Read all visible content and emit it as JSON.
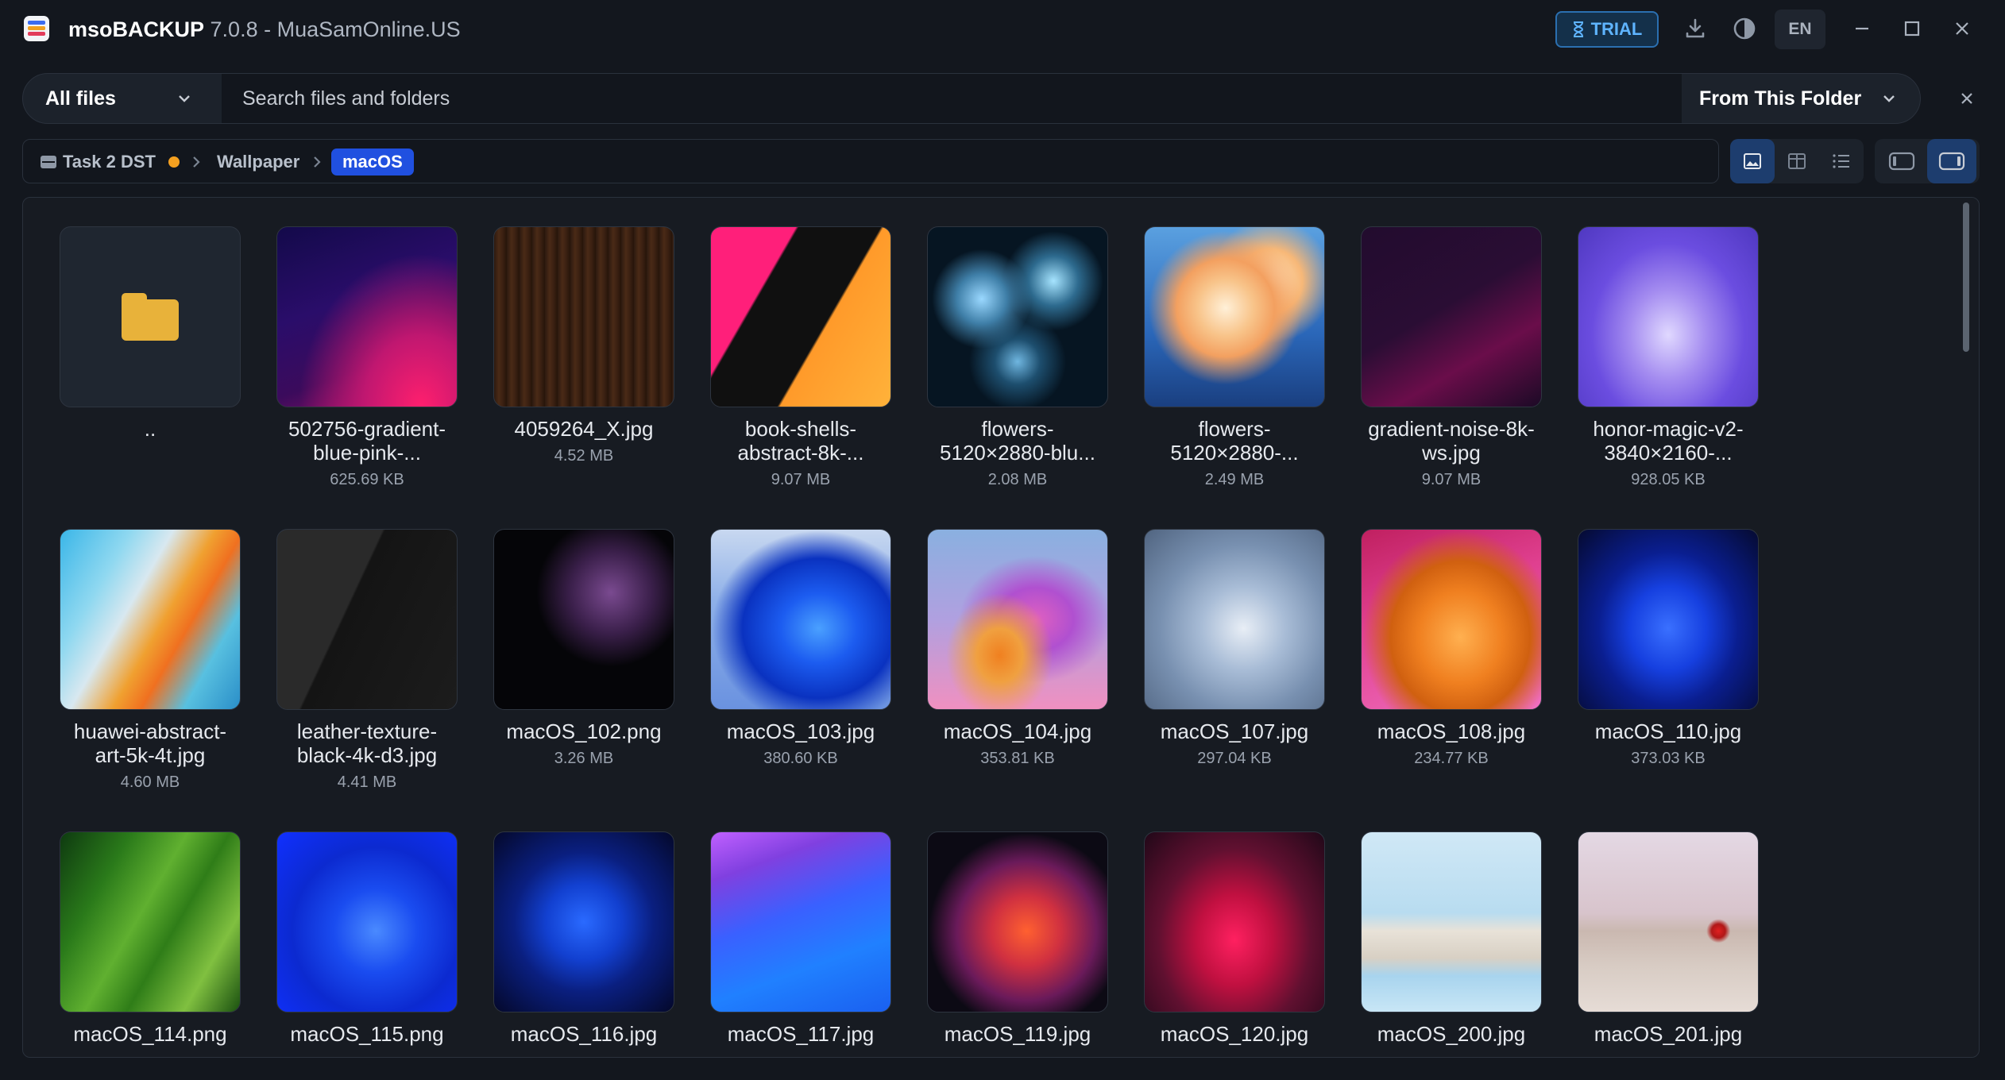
{
  "app": {
    "name": "msoBACKUP",
    "title_rest": " 7.0.8 - MuaSamOnline.US",
    "trial_label": "TRIAL",
    "language": "EN"
  },
  "search": {
    "filter_label": "All files",
    "placeholder": "Search files and folders",
    "value": "",
    "scope_label": "From This Folder"
  },
  "breadcrumb": {
    "items": [
      "Task 2 DST",
      "Wallpaper",
      "macOS"
    ]
  },
  "files": [
    {
      "name": "..",
      "size": "",
      "type": "folder"
    },
    {
      "name": "502756-gradient-blue-pink-...",
      "size": "625.69 KB"
    },
    {
      "name": "4059264_X.jpg",
      "size": "4.52 MB"
    },
    {
      "name": "book-shells-abstract-8k-...",
      "size": "9.07 MB"
    },
    {
      "name": "flowers-5120×2880-blu...",
      "size": "2.08 MB"
    },
    {
      "name": "flowers-5120×2880-...",
      "size": "2.49 MB"
    },
    {
      "name": "gradient-noise-8k-ws.jpg",
      "size": "9.07 MB"
    },
    {
      "name": "honor-magic-v2-3840×2160-...",
      "size": "928.05 KB"
    },
    {
      "name": "huawei-abstract-art-5k-4t.jpg",
      "size": "4.60 MB"
    },
    {
      "name": "leather-texture-black-4k-d3.jpg",
      "size": "4.41 MB"
    },
    {
      "name": "macOS_102.png",
      "size": "3.26 MB"
    },
    {
      "name": "macOS_103.jpg",
      "size": "380.60 KB"
    },
    {
      "name": "macOS_104.jpg",
      "size": "353.81 KB"
    },
    {
      "name": "macOS_107.jpg",
      "size": "297.04 KB"
    },
    {
      "name": "macOS_108.jpg",
      "size": "234.77 KB"
    },
    {
      "name": "macOS_110.jpg",
      "size": "373.03 KB"
    },
    {
      "name": "macOS_114.png",
      "size": ""
    },
    {
      "name": "macOS_115.png",
      "size": ""
    },
    {
      "name": "macOS_116.jpg",
      "size": ""
    },
    {
      "name": "macOS_117.jpg",
      "size": ""
    },
    {
      "name": "macOS_119.jpg",
      "size": ""
    },
    {
      "name": "macOS_120.jpg",
      "size": ""
    },
    {
      "name": "macOS_200.jpg",
      "size": ""
    },
    {
      "name": "macOS_201.jpg",
      "size": ""
    }
  ],
  "icons": {
    "app": "app-logo-icon",
    "trial": "hourglass-icon",
    "download": "download-icon",
    "theme": "contrast-icon",
    "minimize": "minimize-icon",
    "maximize": "maximize-icon",
    "close": "close-icon",
    "views": [
      "gallery-view-icon",
      "columns-view-icon",
      "list-view-icon",
      "panel-left-icon",
      "panel-right-icon"
    ]
  },
  "colors": {
    "accent": "#2050e0",
    "trial": "#5fb4ff",
    "status_dot": "#f4a020",
    "folder": "#e8b23a"
  }
}
